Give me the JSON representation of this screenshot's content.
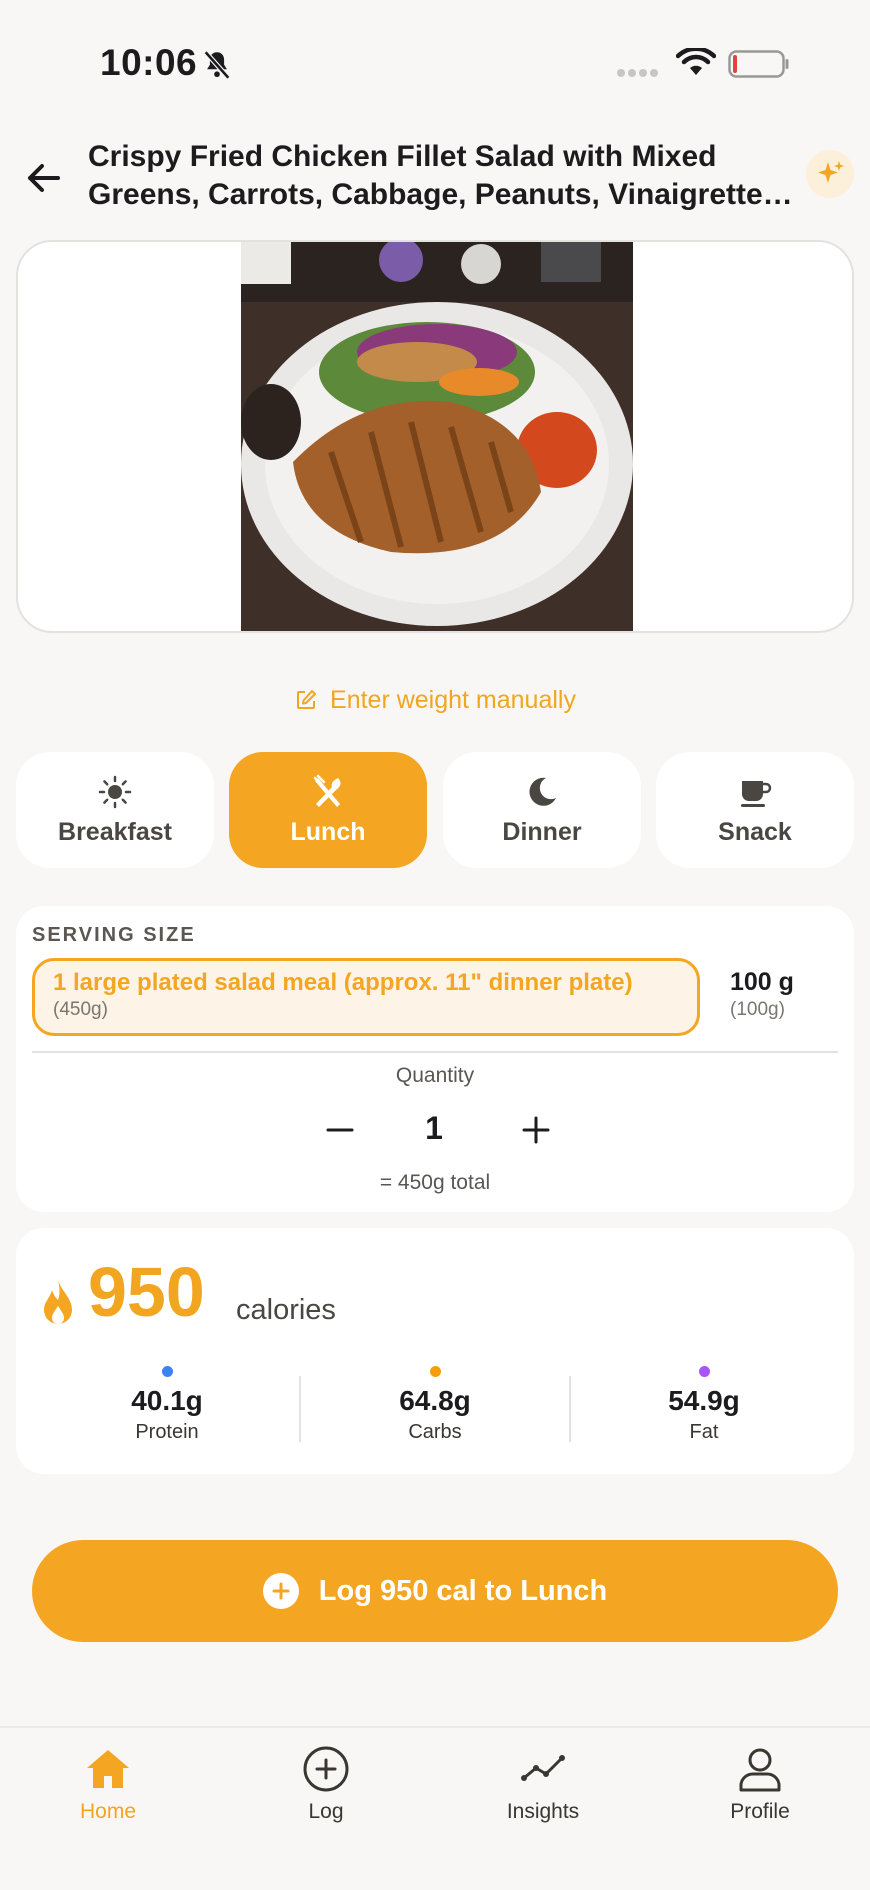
{
  "status_bar": {
    "time": "10:06"
  },
  "header": {
    "title": "Crispy Fried Chicken Fillet Salad with Mixed Greens, Carrots, Cabbage, Peanuts, Vinaigrette and Sweet Chili Sauce"
  },
  "weight_link": {
    "label": "Enter weight manually"
  },
  "meal_tabs": [
    {
      "label": "Breakfast",
      "icon": "sun-icon"
    },
    {
      "label": "Lunch",
      "icon": "fork-knife-icon",
      "active": true
    },
    {
      "label": "Dinner",
      "icon": "moon-icon"
    },
    {
      "label": "Snack",
      "icon": "cup-icon"
    }
  ],
  "serving": {
    "heading": "SERVING SIZE",
    "selected": {
      "label": "1 large plated salad meal (approx. 11\" dinner plate)",
      "grams": "(450g)"
    },
    "alternate": {
      "label": "100 g",
      "grams": "(100g)"
    },
    "quantity_label": "Quantity",
    "quantity": "1",
    "total": "= 450g total"
  },
  "nutrition": {
    "calories": "950",
    "calories_unit": "calories",
    "macros": [
      {
        "value": "40.1g",
        "name": "Protein",
        "color": "#3b82f6"
      },
      {
        "value": "64.8g",
        "name": "Carbs",
        "color": "#f59e0b"
      },
      {
        "value": "54.9g",
        "name": "Fat",
        "color": "#a855f7"
      }
    ]
  },
  "log_button": {
    "label": "Log 950 cal to Lunch"
  },
  "nav": [
    {
      "label": "Home",
      "icon": "home-icon",
      "active": true
    },
    {
      "label": "Log",
      "icon": "plus-circle-icon"
    },
    {
      "label": "Insights",
      "icon": "trend-icon"
    },
    {
      "label": "Profile",
      "icon": "person-icon"
    }
  ],
  "colors": {
    "accent": "#f4a623",
    "background": "#f8f7f5"
  }
}
